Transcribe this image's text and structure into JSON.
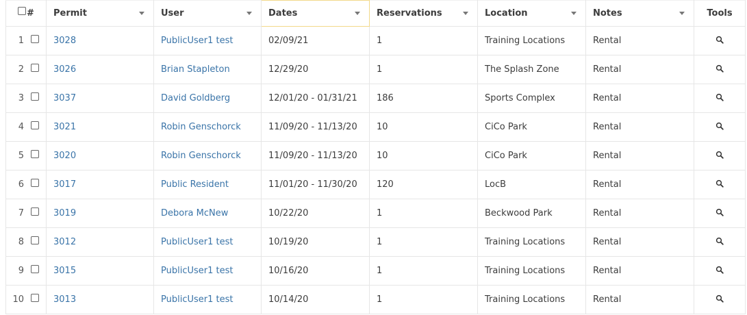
{
  "columns": {
    "number": "#",
    "permit": "Permit",
    "user": "User",
    "dates": "Dates",
    "reservations": "Reservations",
    "location": "Location",
    "notes": "Notes",
    "tools": "Tools"
  },
  "icons": {
    "sort": "caret-down-icon",
    "view": "magnifier-icon"
  },
  "colors": {
    "link": "#3a74a8",
    "active_header_border": "#f2d98a",
    "grid_line": "#e6e6e6"
  },
  "rows": [
    {
      "n": "1",
      "permit": "3028",
      "user": "PublicUser1 test",
      "dates": "02/09/21",
      "reservations": "1",
      "location": "Training Locations",
      "notes": "Rental"
    },
    {
      "n": "2",
      "permit": "3026",
      "user": "Brian Stapleton",
      "dates": "12/29/20",
      "reservations": "1",
      "location": "The Splash Zone",
      "notes": "Rental"
    },
    {
      "n": "3",
      "permit": "3037",
      "user": "David Goldberg",
      "dates": "12/01/20 - 01/31/21",
      "reservations": "186",
      "location": "Sports Complex",
      "notes": "Rental"
    },
    {
      "n": "4",
      "permit": "3021",
      "user": "Robin Genschorck",
      "dates": "11/09/20 - 11/13/20",
      "reservations": "10",
      "location": "CiCo Park",
      "notes": "Rental"
    },
    {
      "n": "5",
      "permit": "3020",
      "user": "Robin Genschorck",
      "dates": "11/09/20 - 11/13/20",
      "reservations": "10",
      "location": "CiCo Park",
      "notes": "Rental"
    },
    {
      "n": "6",
      "permit": "3017",
      "user": "Public Resident",
      "dates": "11/01/20 - 11/30/20",
      "reservations": "120",
      "location": "LocB",
      "notes": "Rental"
    },
    {
      "n": "7",
      "permit": "3019",
      "user": "Debora McNew",
      "dates": "10/22/20",
      "reservations": "1",
      "location": "Beckwood Park",
      "notes": "Rental"
    },
    {
      "n": "8",
      "permit": "3012",
      "user": "PublicUser1 test",
      "dates": "10/19/20",
      "reservations": "1",
      "location": "Training Locations",
      "notes": "Rental"
    },
    {
      "n": "9",
      "permit": "3015",
      "user": "PublicUser1 test",
      "dates": "10/16/20",
      "reservations": "1",
      "location": "Training Locations",
      "notes": "Rental"
    },
    {
      "n": "10",
      "permit": "3013",
      "user": "PublicUser1 test",
      "dates": "10/14/20",
      "reservations": "1",
      "location": "Training Locations",
      "notes": "Rental"
    }
  ]
}
